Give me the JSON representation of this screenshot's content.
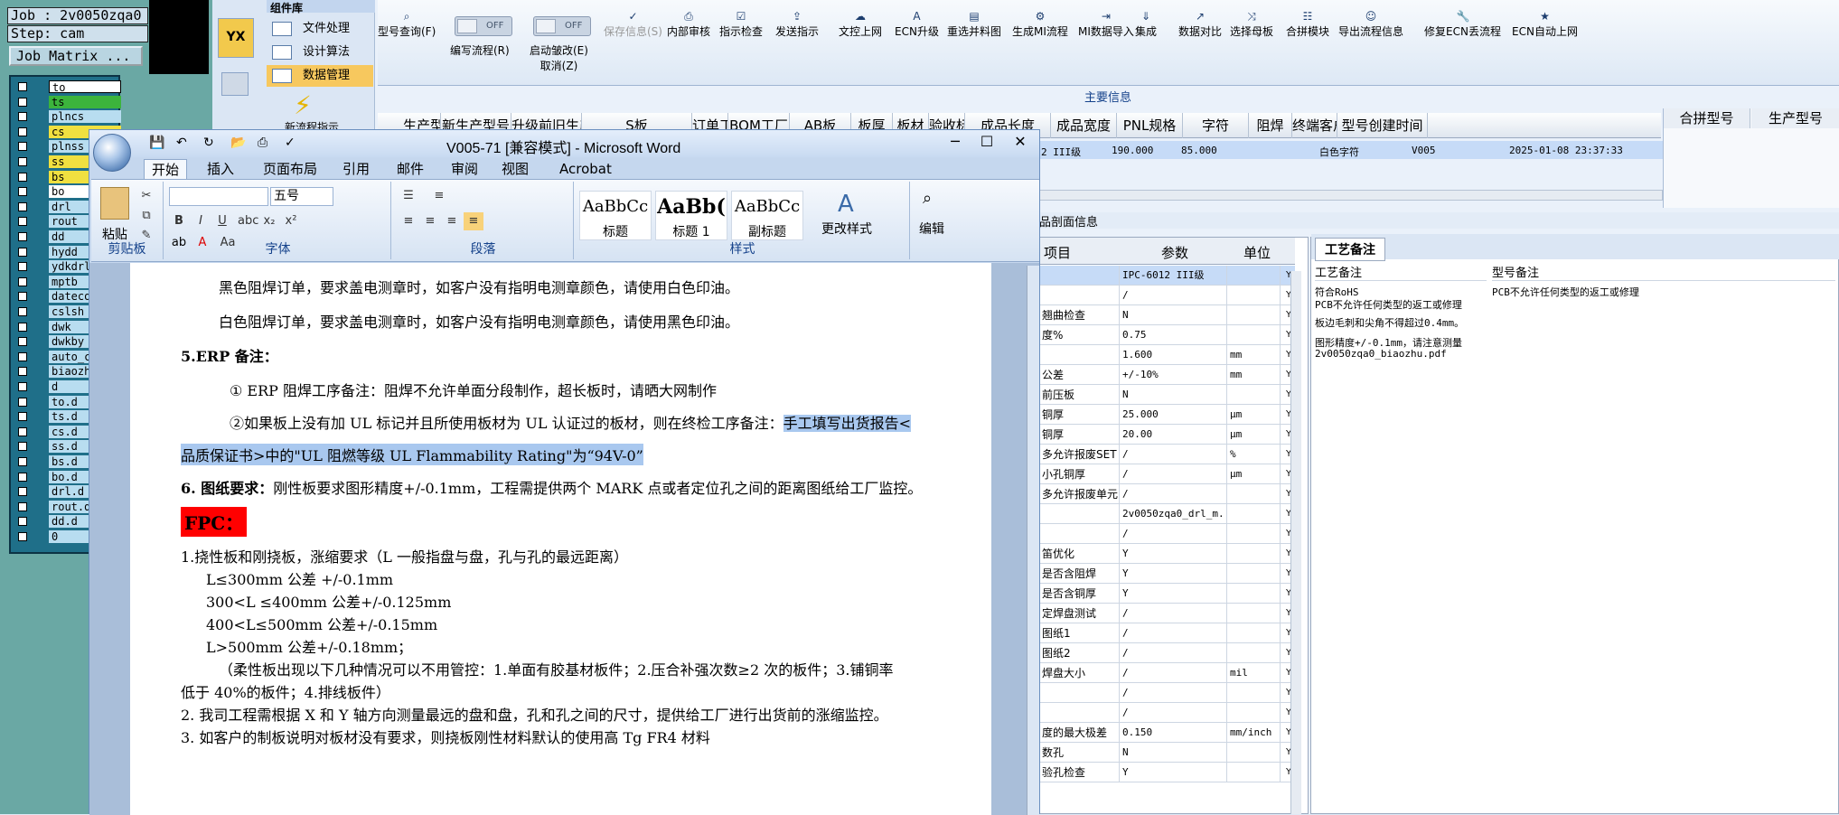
{
  "cam": {
    "job_label": "Job : 2v0050zqa0",
    "step_label": "Step: cam",
    "matrix_button": "Job Matrix ...",
    "layers": [
      "to",
      "ts",
      "plncs",
      "cs",
      "plnss",
      "ss",
      "bs",
      "bo",
      "drl",
      "rout",
      "dd",
      "hydd",
      "ydkdrl",
      "mptb",
      "datecode",
      "cslsh",
      "dwk",
      "dwkby",
      "auto_ch",
      "biaozhu",
      "d",
      "to.d",
      "ts.d",
      "cs.d",
      "ss.d",
      "bs.d",
      "bo.d",
      "drl.d",
      "rout.d",
      "dd.d",
      "0"
    ]
  },
  "nav": {
    "title": "组件库",
    "items": [
      "文件处理",
      "设计算法",
      "数据管理"
    ],
    "new_flow": "新流程指示"
  },
  "toolbar": {
    "buttons": [
      "型号查询(F)",
      "编写流程(R)",
      "启动皱改(E)\n取消(Z)",
      "保存信息(S)",
      "内部审核",
      "指示检查",
      "发送指示",
      "文控上网",
      "ECN升级",
      "重选并料图",
      "生成MI流程",
      "MI数据导入",
      "集成",
      "数据对比",
      "选择母板",
      "合拼模块",
      "导出流程信息",
      "修复ECN丢流程",
      "ECN自动上网"
    ],
    "toggle_off": "OFF",
    "main_info": "主要信息"
  },
  "grid": {
    "headers": [
      "生产型号",
      "新生产型号",
      "升级前旧生产型号",
      "S板",
      "订单工厂",
      "BOM工厂",
      "AB板",
      "板厚",
      "板材",
      "验收标准",
      "成品长度",
      "成品宽度",
      "PNL规格",
      "字符",
      "阻焊",
      "终端客户代码",
      "型号创建时间"
    ],
    "row": {
      "standard": "2 III级",
      "length": "190.000",
      "width": "85.000",
      "char": "白色字符",
      "customer": "V005",
      "created": "2025-01-08 23:37:33"
    },
    "right_headers": [
      "合拼型号",
      "生产型号"
    ]
  },
  "info_header": "品剖面信息",
  "param_table": {
    "headers": [
      "项目",
      "参数",
      "单位"
    ],
    "rows": [
      [
        "",
        "IPC-6012 III级",
        "",
        "Y"
      ],
      [
        "",
        "/",
        "",
        "Y"
      ],
      [
        "翘曲检查",
        "N",
        "",
        "Y"
      ],
      [
        "度%",
        "0.75",
        "",
        "Y"
      ],
      [
        "",
        "1.600",
        "mm",
        "Y"
      ],
      [
        "公差",
        "+/-10%",
        "mm",
        "Y"
      ],
      [
        "前压板",
        "N",
        "",
        "Y"
      ],
      [
        "铜厚",
        "25.000",
        "μm",
        "Y"
      ],
      [
        "铜厚",
        "20.00",
        "μm",
        "Y"
      ],
      [
        "多允许报废SET",
        "/",
        "%",
        "Y"
      ],
      [
        "小孔铜厚",
        "/",
        "μm",
        "Y"
      ],
      [
        "多允许报废单元",
        "/",
        "",
        "Y"
      ],
      [
        "",
        "2v0050zqa0_drl_m...",
        "",
        "Y"
      ],
      [
        "",
        "/",
        "",
        "Y"
      ],
      [
        "笛优化",
        "Y",
        "",
        "Y"
      ],
      [
        "是否含阻焊",
        "Y",
        "",
        "Y"
      ],
      [
        "是否含铜厚",
        "Y",
        "",
        "Y"
      ],
      [
        "定焊盘测试",
        "/",
        "",
        "Y"
      ],
      [
        "图纸1",
        "/",
        "",
        "Y"
      ],
      [
        "图纸2",
        "/",
        "",
        "Y"
      ],
      [
        "焊盘大小",
        "/",
        "mil",
        "Y"
      ],
      [
        "",
        "/",
        "",
        "Y"
      ],
      [
        "",
        "/",
        "",
        "Y"
      ],
      [
        "度的最大极差",
        "0.150",
        "mm/inch",
        "Y"
      ],
      [
        "数孔",
        "N",
        "",
        "Y"
      ],
      [
        "验孔检查",
        "Y",
        "",
        "Y"
      ]
    ]
  },
  "craft": {
    "tab": "工艺备注",
    "col1_header": "工艺备注",
    "col2_header": "型号备注",
    "col1_lines": [
      "符合RoHS",
      "PCB不允许任何类型的返工或修理",
      "板边毛刺和尖角不得超过0.4mm。",
      "图形精度+/-0.1mm，请注意测量",
      "2v0050zqa0_biaozhu.pdf"
    ],
    "col2_lines": [
      "PCB不允许任何类型的返工或修理"
    ]
  },
  "word": {
    "title": "V005-71 [兼容模式] - Microsoft Word",
    "tabs": [
      "开始",
      "插入",
      "页面布局",
      "引用",
      "邮件",
      "审阅",
      "视图",
      "Acrobat"
    ],
    "groups": [
      "剪贴板",
      "字体",
      "段落",
      "样式",
      "编辑"
    ],
    "paste": "粘贴",
    "font_size": "五号",
    "styles": [
      {
        "sample": "AaBbCc",
        "name": "标题"
      },
      {
        "sample": "AaBb(",
        "name": "标题 1"
      },
      {
        "sample": "AaBbCc",
        "name": "副标题"
      }
    ],
    "change_styles": "更改样式",
    "edit": "编辑",
    "doc": {
      "l1": "黑色阻焊订单，要求盖电测章时，如客户没有指明电测章颜色，请使用白色印油。",
      "l2": "白色阻焊订单，要求盖电测章时，如客户没有指明电测章颜色，请使用黑色印油。",
      "l3": "5.ERP 备注：",
      "l4": "① ERP 阻焊工序备注：阻焊不允许单面分段制作，超长板时，请晒大网制作",
      "l5a": "②如果板上没有加 UL 标记并且所使用板材为 UL 认证过的板材，则在终检工序备注：",
      "l5b": "手工填写出货报告<",
      "l6": "品质保证书>中的\"UL 阻燃等级 UL Flammability Rating\"为“94V-0”",
      "l7a": "6. 图纸要求：",
      "l7b": "刚性板要求图形精度+/-0.1mm，工程需提供两个 MARK 点或者定位孔之间的距离图纸给工厂监控。",
      "l8": "FPC：",
      "l9": "1.挠性板和刚挠板，涨缩要求（L 一般指盘与盘，孔与孔的最远距离）",
      "l10": "L≤300mm 公差 +/-0.1mm",
      "l11": "300<L ≤400mm 公差+/-0.125mm",
      "l12": "400<L≤500mm 公差+/-0.15mm",
      "l13": "L>500mm 公差+/-0.18mm；",
      "l14": "（柔性板出现以下几种情况可以不用管控：1.单面有胶基材板件；2.压合补强次数≥2 次的板件；3.铺铜率",
      "l15": "低于 40%的板件；4.排线板件）",
      "l16": "2.   我司工程需根据 X 和 Y 轴方向测量最远的盘和盘，孔和孔之间的尺寸，提供给工厂进行出货前的涨缩监控。",
      "l17": "3. 如客户的制板说明对板材没有要求，则挠板刚性材料默认的使用高 Tg FR4 材料"
    }
  }
}
